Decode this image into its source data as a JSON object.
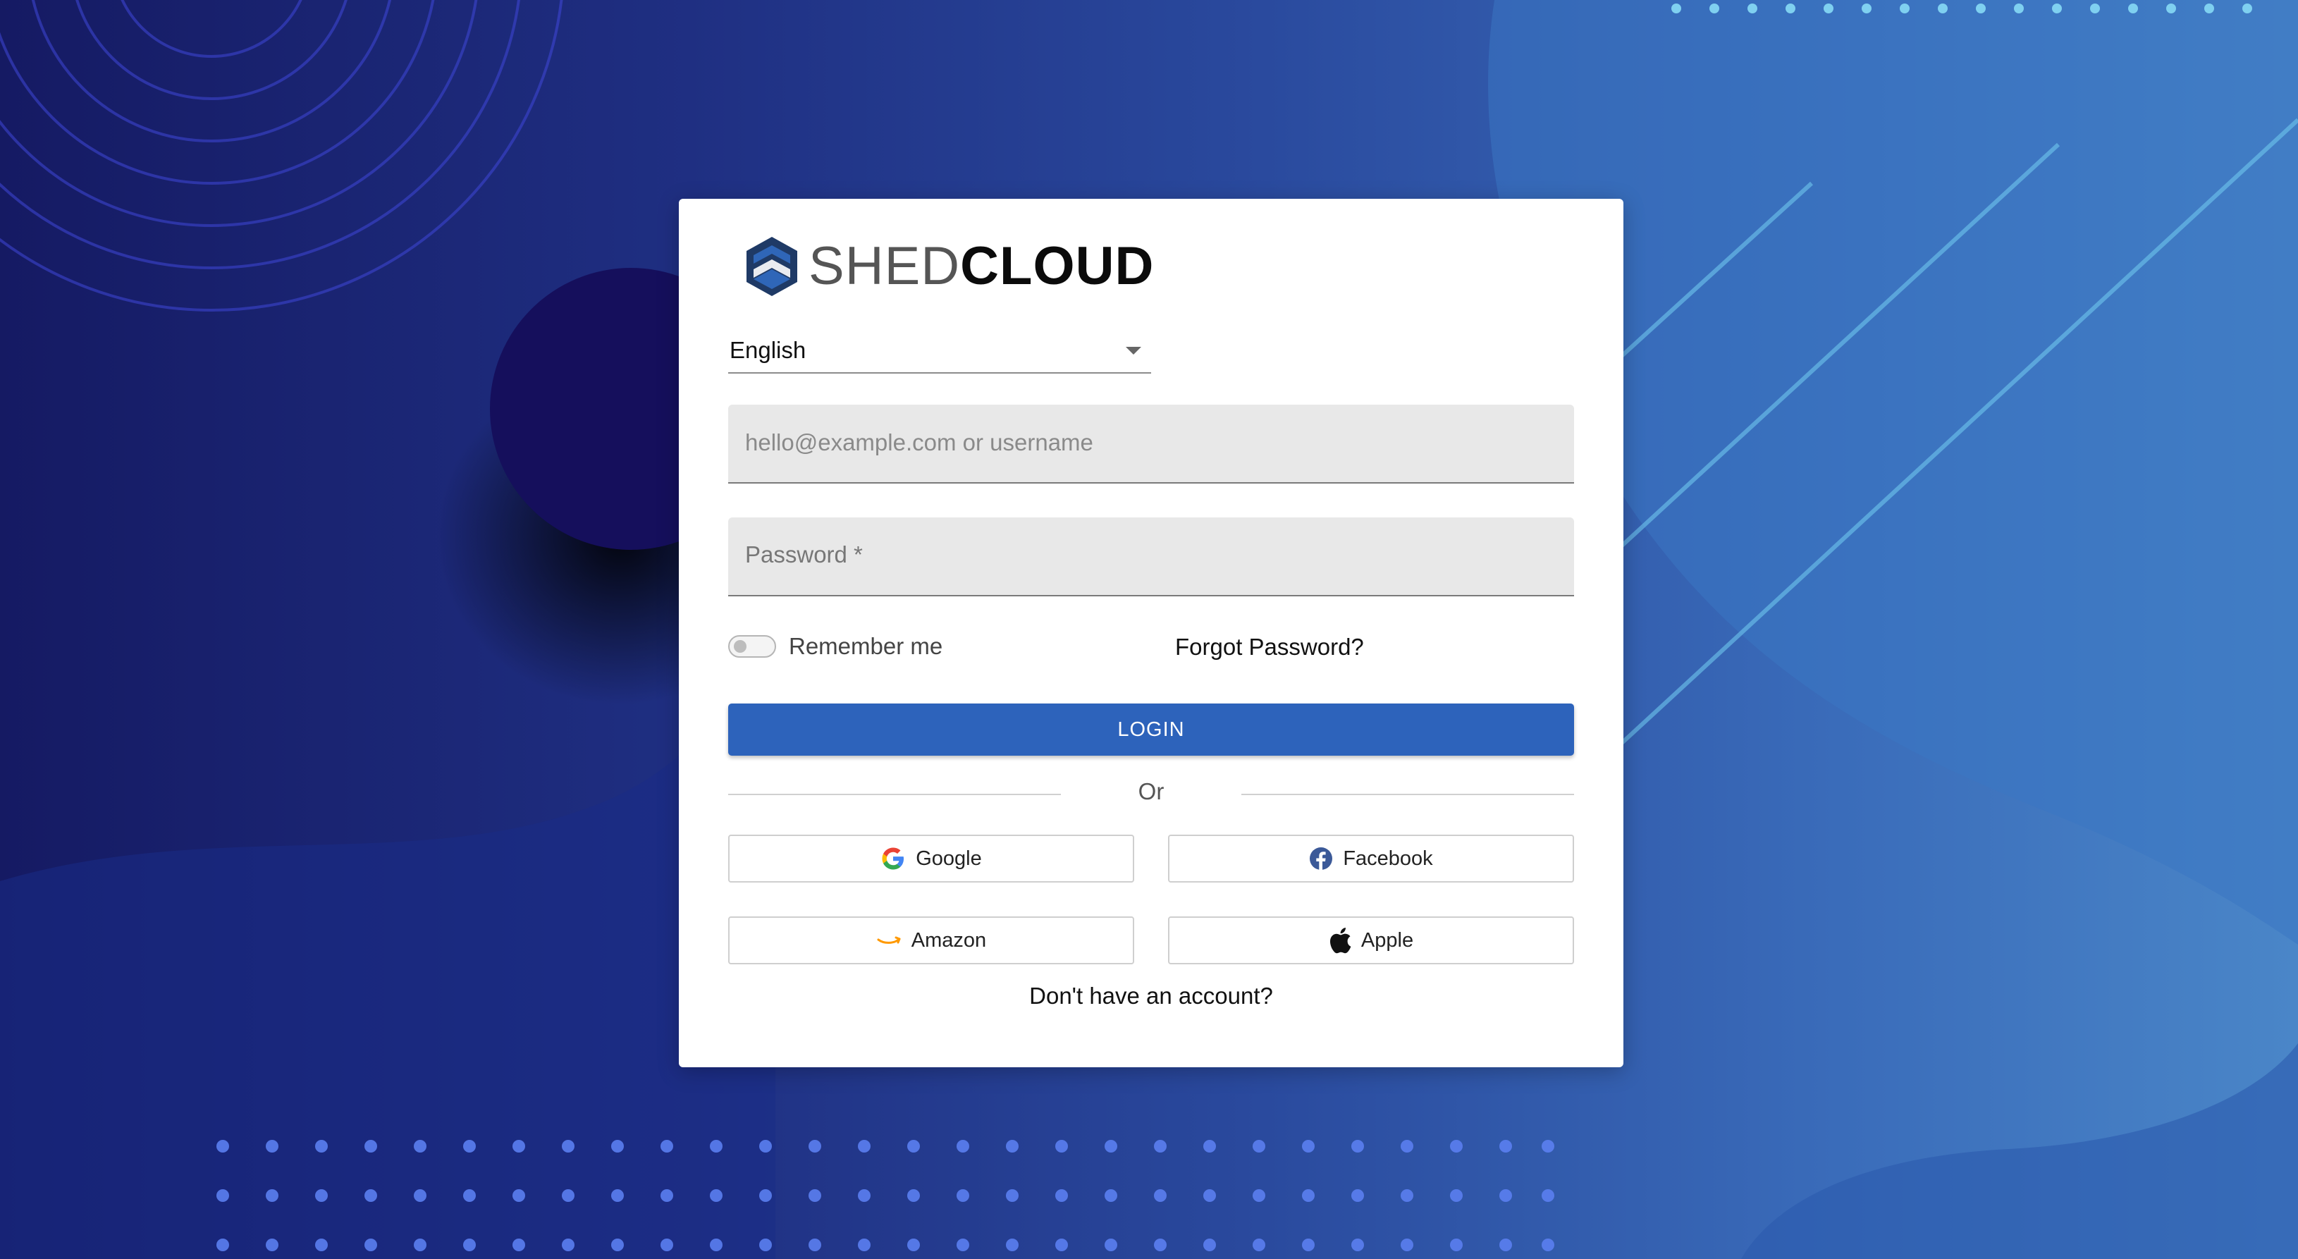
{
  "brand": {
    "logo_prefix": "SHED",
    "logo_suffix": "CLOUD"
  },
  "language": {
    "selected": "English"
  },
  "form": {
    "username_placeholder": "hello@example.com or username",
    "password_label": "Password *",
    "remember_label": "Remember me",
    "remember_checked": false,
    "forgot_label": "Forgot Password?",
    "login_label": "LOGIN",
    "divider_label": "Or"
  },
  "social": {
    "google": "Google",
    "facebook": "Facebook",
    "amazon": "Amazon",
    "apple": "Apple"
  },
  "signup_label": "Don't have an account?",
  "colors": {
    "primary": "#2d63bb",
    "facebook": "#3b5998",
    "amazon": "#ff9900"
  }
}
